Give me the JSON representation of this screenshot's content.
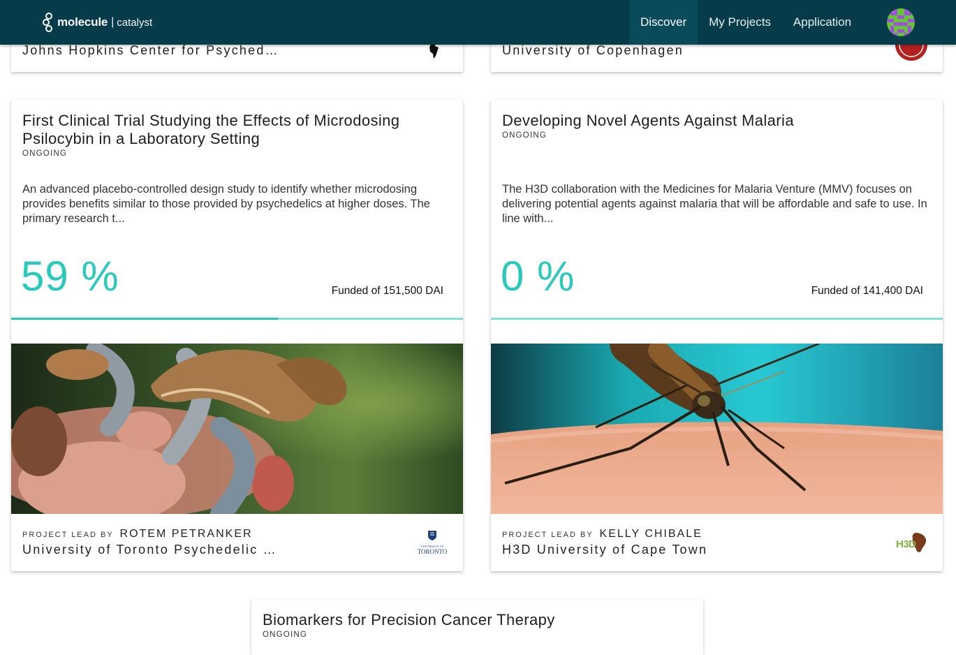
{
  "nav": {
    "brand_name": "molecule",
    "brand_sep": "|",
    "brand_sub": "catalyst",
    "links": [
      {
        "label": "Discover",
        "active": true
      },
      {
        "label": "My Projects",
        "active": false
      },
      {
        "label": "Application",
        "active": false
      }
    ]
  },
  "top_cards": {
    "left_org": "Johns Hopkins Center for Psyched…",
    "right_org": "University of Copenhagen"
  },
  "projects": [
    {
      "title": "First Clinical Trial Studying the Effects of Microdosing Psilocybin in a Laboratory Setting",
      "status": "ONGOING",
      "description": "An advanced placebo-controlled design study to identify whether microdosing provides benefits similar to those provided by psychedelics at higher doses. The primary research t...",
      "percent_text": "59 %",
      "funded_fraction": 0.59,
      "funded_text": "Funded of 151,500 DAI",
      "lead_label": "PROJECT LEAD BY",
      "lead_name": "ROTEM PETRANKER",
      "lead_org": "University of Toronto Psychedelic …",
      "logo_top": "UNIVERSITY OF",
      "logo_bottom": "TORONTO"
    },
    {
      "title": "Developing Novel Agents Against Malaria",
      "status": "ONGOING",
      "description": "The H3D collaboration with the Medicines for Malaria Venture (MMV) focuses on delivering potential agents against malaria that will be affordable and safe to use. In line with...",
      "percent_text": "0 %",
      "funded_fraction": 0,
      "funded_text": "Funded of 141,400 DAI",
      "lead_label": "PROJECT LEAD BY",
      "lead_name": "KELLY CHIBALE",
      "lead_org": "H3D University of Cape Town",
      "logo_text": "H3D"
    },
    {
      "title": "Biomarkers for Precision Cancer Therapy",
      "status": "ONGOING"
    }
  ],
  "colors": {
    "navbar": "#063c4a",
    "accent": "#29c9bd",
    "progress_track": "#7fe0db"
  }
}
